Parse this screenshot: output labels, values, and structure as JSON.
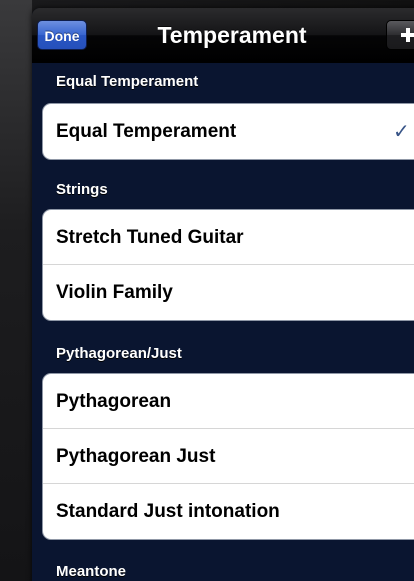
{
  "navbar": {
    "done_label": "Done",
    "title": "Temperament",
    "add_icon": "plus-icon"
  },
  "sections": [
    {
      "header": "Equal Temperament",
      "items": [
        {
          "label": "Equal Temperament",
          "selected": true
        }
      ]
    },
    {
      "header": "Strings",
      "items": [
        {
          "label": "Stretch Tuned Guitar",
          "selected": false
        },
        {
          "label": "Violin Family",
          "selected": false
        }
      ]
    },
    {
      "header": "Pythagorean/Just",
      "items": [
        {
          "label": "Pythagorean",
          "selected": false
        },
        {
          "label": "Pythagorean Just",
          "selected": false
        },
        {
          "label": "Standard Just intonation",
          "selected": false
        }
      ]
    },
    {
      "header": "Meantone",
      "items": []
    }
  ],
  "checkmark_glyph": "✓",
  "colors": {
    "background": "#0a1530",
    "done_button": "#3865d0",
    "checkmark": "#385487"
  }
}
